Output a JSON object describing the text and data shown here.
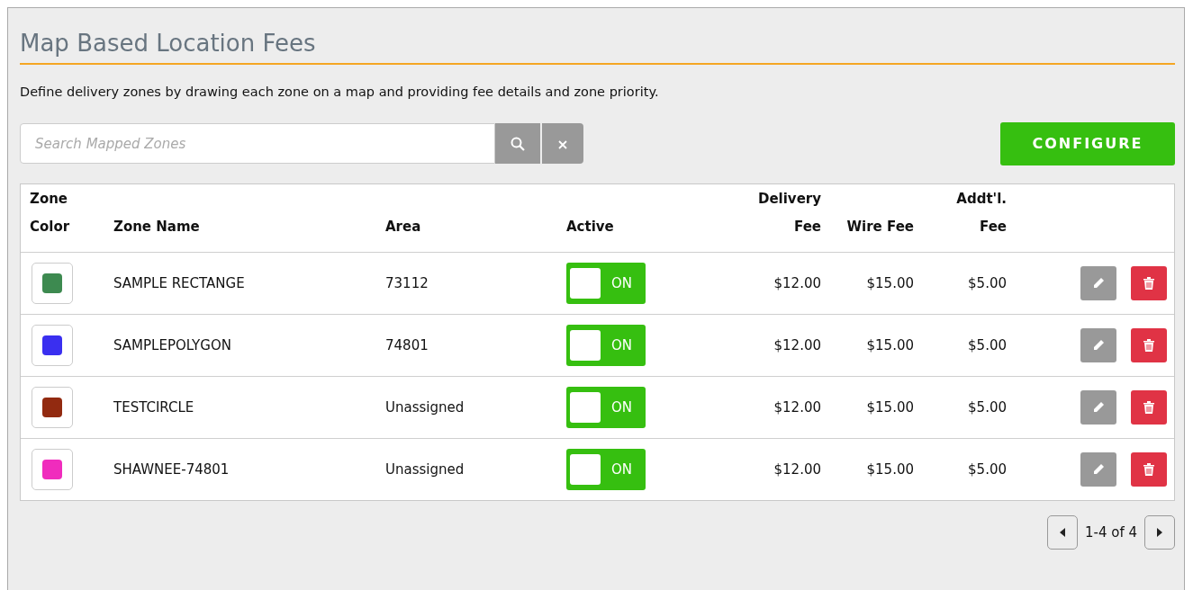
{
  "title": "Map Based Location Fees",
  "description": "Define delivery zones by drawing each zone on a map and providing fee details and zone priority.",
  "search": {
    "placeholder": "Search Mapped Zones"
  },
  "configure_button": "CONFIGURE",
  "table": {
    "columns": [
      {
        "lines": [
          "Zone",
          "Color"
        ]
      },
      {
        "lines": [
          "Zone Name"
        ]
      },
      {
        "lines": [
          "Area"
        ]
      },
      {
        "lines": [
          "Active"
        ]
      },
      {
        "lines": [
          "Delivery",
          "Fee"
        ]
      },
      {
        "lines": [
          "Wire Fee"
        ]
      },
      {
        "lines": [
          "Addt'l.",
          "Fee"
        ]
      }
    ],
    "rows": [
      {
        "color": "#3d8a50",
        "name": "SAMPLE RECTANGE",
        "area": "73112",
        "active": true,
        "toggle_label": "ON",
        "delivery_fee": "$12.00",
        "wire_fee": "$15.00",
        "addtl_fee": "$5.00"
      },
      {
        "color": "#3a2ff0",
        "name": "SAMPLEPOLYGON",
        "area": "74801",
        "active": true,
        "toggle_label": "ON",
        "delivery_fee": "$12.00",
        "wire_fee": "$15.00",
        "addtl_fee": "$5.00"
      },
      {
        "color": "#922a10",
        "name": "TESTCIRCLE",
        "area": "Unassigned",
        "active": true,
        "toggle_label": "ON",
        "delivery_fee": "$12.00",
        "wire_fee": "$15.00",
        "addtl_fee": "$5.00"
      },
      {
        "color": "#f02cbd",
        "name": "SHAWNEE-74801",
        "area": "Unassigned",
        "active": true,
        "toggle_label": "ON",
        "delivery_fee": "$12.00",
        "wire_fee": "$15.00",
        "addtl_fee": "$5.00"
      }
    ]
  },
  "pagination": {
    "range": "1-4 of 4"
  }
}
